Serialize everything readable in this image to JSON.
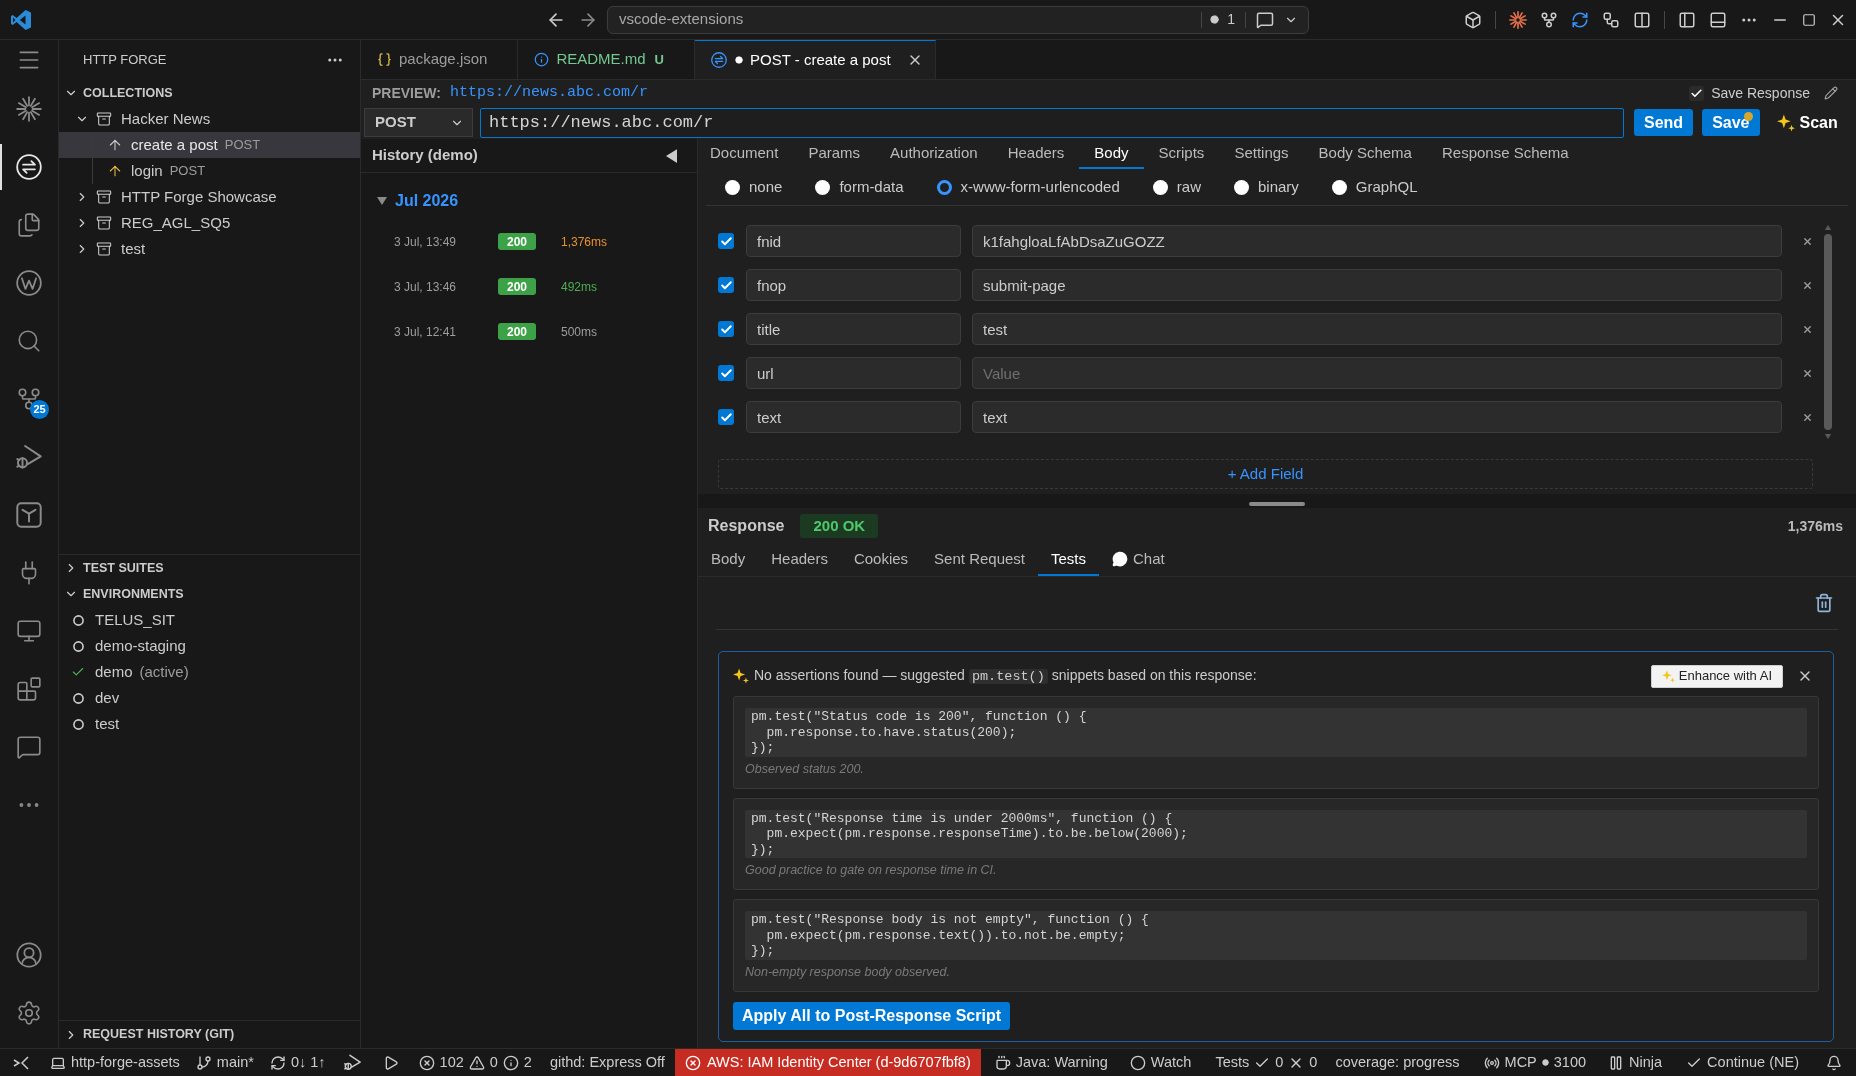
{
  "title_bar": {
    "search": "vscode-extensions",
    "notification_count": "1"
  },
  "activity_bar": {
    "items": [
      {
        "selected": false
      },
      {
        "selected": false
      },
      {
        "selected": true
      },
      {
        "selected": false
      },
      {
        "selected": false
      },
      {
        "selected": false
      },
      {
        "selected": false,
        "badge": "25"
      },
      {
        "selected": false
      },
      {
        "selected": false
      },
      {
        "selected": false
      },
      {
        "selected": false
      },
      {
        "selected": false
      },
      {
        "selected": false
      },
      {
        "selected": false
      }
    ]
  },
  "sidebar": {
    "title": "HTTP FORGE",
    "collections": {
      "title": "COLLECTIONS",
      "expanded": true,
      "items": [
        {
          "name": "Hacker News",
          "expanded": true,
          "children": [
            {
              "name": "create a post",
              "method": "POST",
              "selected": true
            },
            {
              "name": "login",
              "method": "POST",
              "selected": false
            }
          ]
        },
        {
          "name": "HTTP Forge Showcase",
          "expanded": false
        },
        {
          "name": "REG_AGL_SQ5",
          "expanded": false
        },
        {
          "name": "test",
          "expanded": false
        }
      ]
    },
    "test_suites": {
      "title": "TEST SUITES",
      "expanded": false
    },
    "environments": {
      "title": "ENVIRONMENTS",
      "expanded": true,
      "items": [
        {
          "name": "TELUS_SIT",
          "active": false
        },
        {
          "name": "demo-staging",
          "active": false
        },
        {
          "name": "demo",
          "active": true,
          "note": "(active)"
        },
        {
          "name": "dev",
          "active": false
        },
        {
          "name": "test",
          "active": false
        }
      ]
    },
    "request_history": {
      "title": "REQUEST HISTORY (GIT)",
      "expanded": false
    }
  },
  "editor_tabs": [
    {
      "kind": "json",
      "label": "package.json",
      "selected": false
    },
    {
      "kind": "info",
      "label": "README.md",
      "status": "U",
      "selected": false
    },
    {
      "kind": "request",
      "label": "POST - create a post",
      "modified": true,
      "selected": true
    }
  ],
  "preview": {
    "label": "PREVIEW:",
    "url": "https://news.abc.com/r"
  },
  "save_response": {
    "label": "Save Response",
    "checked": true
  },
  "request": {
    "method": "POST",
    "url": "https://news.abc.com/r"
  },
  "actions": [
    {
      "kind": "send",
      "label": "Send"
    },
    {
      "kind": "save",
      "label": "Save",
      "unsaved": true
    },
    {
      "kind": "scan",
      "label": "Scan"
    }
  ],
  "history": {
    "title": "History (demo)",
    "groups": [
      {
        "label": "Jul 2026",
        "expanded": true,
        "entries": [
          {
            "time": "3 Jul, 13:49",
            "status": "200",
            "duration": "1,376ms",
            "color": "#e8912d"
          },
          {
            "time": "3 Jul, 13:46",
            "status": "200",
            "duration": "492ms",
            "color": "#4caf50"
          },
          {
            "time": "3 Jul, 12:41",
            "status": "200",
            "duration": "500ms",
            "color": "#9d9d9d"
          }
        ]
      }
    ]
  },
  "request_tabs": [
    {
      "label": "Document",
      "selected": false
    },
    {
      "label": "Params",
      "selected": false
    },
    {
      "label": "Authorization",
      "selected": false
    },
    {
      "label": "Headers",
      "selected": false
    },
    {
      "label": "Body",
      "selected": true
    },
    {
      "label": "Scripts",
      "selected": false
    },
    {
      "label": "Settings",
      "selected": false
    },
    {
      "label": "Body Schema",
      "selected": false
    },
    {
      "label": "Response Schema",
      "selected": false
    }
  ],
  "body_types": [
    {
      "label": "none",
      "selected": false
    },
    {
      "label": "form-data",
      "selected": false
    },
    {
      "label": "x-www-form-urlencoded",
      "selected": true
    },
    {
      "label": "raw",
      "selected": false
    },
    {
      "label": "binary",
      "selected": false
    },
    {
      "label": "GraphQL",
      "selected": false
    }
  ],
  "form_fields": [
    {
      "checked": true,
      "key": "fnid",
      "value": "k1fahgloaLfAbDsaZuGOZZ"
    },
    {
      "checked": true,
      "key": "fnop",
      "value": "submit-page"
    },
    {
      "checked": true,
      "key": "title",
      "value": "test"
    },
    {
      "checked": true,
      "key": "url",
      "placeholder": "Value"
    },
    {
      "checked": true,
      "key": "text",
      "value": "text"
    }
  ],
  "add_field": "+ Add Field",
  "response": {
    "title": "Response",
    "status": "200 OK",
    "time": "1,376ms",
    "tabs": [
      {
        "kind": "plain",
        "label": "Body",
        "selected": false
      },
      {
        "kind": "plain",
        "label": "Headers",
        "selected": false
      },
      {
        "kind": "plain",
        "label": "Cookies",
        "selected": false
      },
      {
        "kind": "plain",
        "label": "Sent Request",
        "selected": false
      },
      {
        "kind": "plain",
        "label": "Tests",
        "selected": true
      },
      {
        "kind": "chat",
        "label": "Chat",
        "selected": false
      }
    ],
    "suggestions": {
      "lead": "No assertions found — suggested",
      "code": "pm.test()",
      "tail": "snippets based on this response:",
      "enhance": "Enhance with AI",
      "snippets": [
        {
          "code": "pm.test(\"Status code is 200\", function () {\n  pm.response.to.have.status(200);\n});",
          "note": "Observed status 200."
        },
        {
          "code": "pm.test(\"Response time is under 2000ms\", function () {\n  pm.expect(pm.response.responseTime).to.be.below(2000);\n});",
          "note": "Good practice to gate on response time in CI."
        },
        {
          "code": "pm.test(\"Response body is not empty\", function () {\n  pm.expect(pm.response.text()).to.not.be.empty;\n});",
          "note": "Non-empty response body observed."
        }
      ],
      "apply": "Apply All to Post-Response Script"
    }
  },
  "status_bar": {
    "items": [
      {
        "kind": "remote"
      },
      {
        "kind": "workspace",
        "text": "http-forge-assets"
      },
      {
        "kind": "branch",
        "text": "main*"
      },
      {
        "kind": "sync",
        "text": "0↓ 1↑"
      },
      {
        "kind": "debug"
      },
      {
        "kind": "run"
      },
      {
        "kind": "problems",
        "errors": "102",
        "warnings": "0",
        "infos": "2"
      },
      {
        "kind": "plain",
        "text": "githd: Express Off"
      },
      {
        "kind": "alert",
        "text": "AWS: IAM Identity Center (d-9d6707fbf8)"
      },
      {
        "kind": "java",
        "text": "Java: Warning"
      },
      {
        "kind": "watch",
        "text": "Watch"
      },
      {
        "kind": "tests",
        "text": "Tests",
        "passed": "0",
        "failed": "0"
      },
      {
        "kind": "plain",
        "text": "coverage: progress"
      },
      {
        "kind": "mcp",
        "text": "MCP",
        "port": "3100"
      },
      {
        "kind": "ninja",
        "text": "Ninja"
      },
      {
        "kind": "continue",
        "text": "Continue (NE)"
      },
      {
        "kind": "notifications"
      }
    ]
  }
}
